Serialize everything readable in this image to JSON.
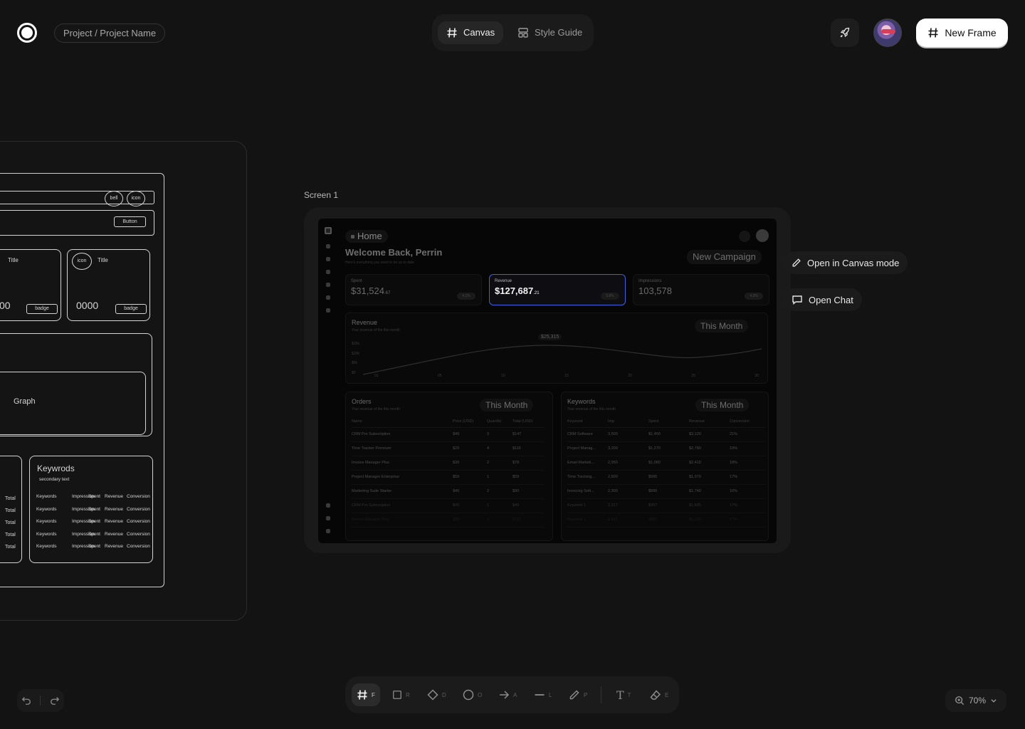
{
  "header": {
    "breadcrumb": "Project / Project Name",
    "tabs": [
      {
        "label": "Canvas"
      },
      {
        "label": "Style Guide"
      }
    ],
    "new_frame_label": "New Frame"
  },
  "wireframe": {
    "icon_labels": [
      "bell",
      "icon"
    ],
    "button_label": "Button",
    "card_title": "Title",
    "card_value_left": "00",
    "card_value": "0000",
    "badge_label": "badge",
    "card_icon_label": "icon",
    "graph_label": "Graph",
    "keywords_title": "Keywrods",
    "keywords_subtitle": "secondary text",
    "keywords_columns": [
      "Keywords",
      "Impression",
      "Spent",
      "Revenue",
      "Conversion"
    ],
    "total_label": "Total"
  },
  "screen": {
    "label": "Screen 1",
    "breadcrumb": "Home",
    "welcome": "Welcome Back, Perrin",
    "welcome_sub": "Here's everything you need to be up to date",
    "new_campaign": "New Campaign",
    "cards": [
      {
        "label": "Spent",
        "value": "$31,524",
        "cents": ".67",
        "chip": "4.1%"
      },
      {
        "label": "Revenue",
        "value": "$127,687",
        "cents": ".21",
        "chip": "3.8%"
      },
      {
        "label": "Impressions",
        "value": "103,578",
        "cents": "",
        "chip": "4.3%"
      }
    ],
    "revenue_title": "Revenue",
    "revenue_sub": "Your revenue of the this month",
    "range_label": "This Month",
    "peak_label": "$25,315",
    "y_ticks": [
      "$15k",
      "$10k",
      "$5k",
      "$0"
    ],
    "x_ticks": [
      "01",
      "05",
      "10",
      "15",
      "20",
      "25",
      "30"
    ],
    "orders": {
      "title": "Orders",
      "subtitle": "Your revenue of the this month",
      "columns": [
        "Name",
        "Price (USD)",
        "Quantity",
        "Total (USD)"
      ],
      "rows": [
        [
          "CRM Pro Subscription",
          "$49",
          "3",
          "$147"
        ],
        [
          "Time Tracker Premium",
          "$29",
          "4",
          "$116"
        ],
        [
          "Invoice Manager Plus",
          "$39",
          "2",
          "$78"
        ],
        [
          "Project Manager Enterprise",
          "$59",
          "1",
          "$59"
        ],
        [
          "Marketing Suite Starter",
          "$45",
          "2",
          "$90"
        ],
        [
          "CRM Pro Subscription",
          "$49",
          "1",
          "$49"
        ],
        [
          "Invoice Manager Plus",
          "$39",
          "3",
          "$117"
        ]
      ]
    },
    "keywords": {
      "title": "Keywords",
      "subtitle": "Your revenue of the this month",
      "columns": [
        "Keyword",
        "Imp",
        "Spent",
        "Revenue",
        "Conversion"
      ],
      "rows": [
        [
          "CRM Software",
          "3,500",
          "$1,450",
          "$3,120",
          "21%"
        ],
        [
          "Project Manag...",
          "3,200",
          "$1,270",
          "$2,780",
          "19%"
        ],
        [
          "Email Marketi...",
          "2,950",
          "$1,080",
          "$2,410",
          "18%"
        ],
        [
          "Time Tracking...",
          "2,600",
          "$995",
          "$1,970",
          "17%"
        ],
        [
          "Invoicing Soft...",
          "2,300",
          "$890",
          "$1,740",
          "16%"
        ],
        [
          "Keyword 1",
          "2,317",
          "$957",
          "$1,685",
          "17%"
        ],
        [
          "Keyword 1",
          "2,517",
          "$957",
          "$1,125",
          "17%"
        ]
      ]
    }
  },
  "side_actions": {
    "open_canvas": "Open in Canvas mode",
    "open_chat": "Open Chat"
  },
  "toolbar": {
    "keys": [
      "F",
      "R",
      "D",
      "O",
      "A",
      "L",
      "P",
      "T",
      "E"
    ]
  },
  "zoom": {
    "level": "70%"
  }
}
